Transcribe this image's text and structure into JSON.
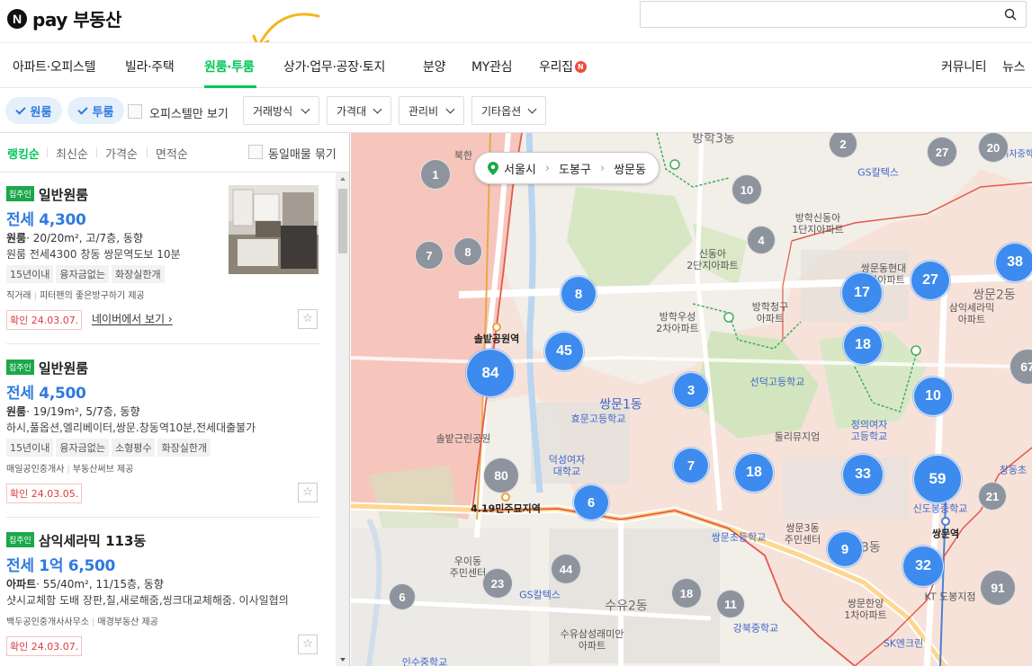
{
  "header": {
    "logo_n": "N",
    "logo_text": "pay 부동산"
  },
  "nav": {
    "items": [
      "아파트·오피스텔",
      "빌라·주택",
      "원룸·투룸",
      "상가·업무·공장·토지",
      "분양",
      "MY관심",
      "우리집"
    ],
    "active_index": 2,
    "badge": "N",
    "right": [
      "커뮤니티",
      "뉴스"
    ]
  },
  "filters": {
    "chip_oneroom": "원룸",
    "chip_tworoom": "투룸",
    "officetel_only": "오피스텔만 보기",
    "dropdowns": [
      "거래방식",
      "가격대",
      "관리비",
      "기타옵션"
    ]
  },
  "sort": {
    "items": [
      "랭킹순",
      "최신순",
      "가격순",
      "면적순"
    ],
    "active_index": 0,
    "group_label": "동일매물 묶기"
  },
  "listings": [
    {
      "badge": "집주인",
      "title": "일반원룸",
      "price": "전세 4,300",
      "spec_type": "원룸",
      "spec": "· 20/20m², 고/7층, 동향",
      "desc": "원룸 전세4300 창동 쌍문역도보 10분",
      "tags": [
        "15년이내",
        "융자금없는",
        "화장실한개"
      ],
      "agent": "직거래",
      "provider": "피터팬의 좋은방구하기 제공",
      "confirm": "확인 24.03.07.",
      "link": "네이버에서 보기 ›"
    },
    {
      "badge": "집주인",
      "title": "일반원룸",
      "price": "전세 4,500",
      "spec_type": "원룸",
      "spec": "· 19/19m², 5/7층, 동향",
      "desc": "하시,풀옵션,엘리베이터,쌍문.창동역10분,전세대출불가",
      "tags": [
        "15년이내",
        "융자금없는",
        "소형평수",
        "화장실한개"
      ],
      "agent": "매일공인중개사",
      "provider": "부동산써브 제공",
      "confirm": "확인 24.03.05."
    },
    {
      "badge": "집주인",
      "title": "삼익세라믹 113동",
      "price": "전세 1억 6,500",
      "spec_type": "아파트",
      "spec": "· 55/40m², 11/15층, 동향",
      "desc": "샷시교체함 도배 장판,칠,새로해줌,씽크대교체해줌. 이사일협의",
      "agent": "백두공인중개사사무소",
      "provider": "매경부동산 제공",
      "confirm": "확인 24.03.07."
    }
  ],
  "map": {
    "breadcrumb": [
      "서울시",
      "도봉구",
      "쌍문동"
    ],
    "clusters_blue": [
      "8",
      "45",
      "84",
      "3",
      "7",
      "18",
      "6",
      "17",
      "27",
      "38",
      "18",
      "10",
      "33",
      "59",
      "9",
      "32"
    ],
    "clusters_grey": [
      "1",
      "7",
      "8",
      "10",
      "4",
      "2",
      "27",
      "20",
      "80",
      "44",
      "23",
      "6",
      "18",
      "11",
      "21",
      "91",
      "67"
    ],
    "labels": {
      "banghak3": "방학3동",
      "ssangmun1": "쌍문1동",
      "ssangmun2": "쌍문2동",
      "ssangmun3": "쌍문3동",
      "suyu2": "수유2동",
      "solbat_station": "솔밭공원역",
      "solbat_park": "솔밭근린공원",
      "minju_station": "4.19민주묘지역",
      "ssangmun_station": "쌍문역",
      "gs_caltex_top": "GS칼텍스",
      "gs_caltex_bottom": "GS칼텍스",
      "banghak_sindonga1": "방학신동아\n1단지아파트",
      "sindonga2": "신동아\n2단지아파트",
      "banghak_woosung": "방학우성\n2차아파트",
      "banghak_chunggu": "방학청구\n아파트",
      "ssangmun_hyundai": "쌍문동현대\n1차아파트",
      "samik_ceramic": "삼익세라믹\n아파트",
      "sundeok_high": "선덕고등학교",
      "dulle_museum": "둘리뮤지엄",
      "jeongui_girls": "정의여자\n고등학교",
      "hyomun_high": "효문고등학교",
      "duksung": "덕성여자\n대학교",
      "ssangmun_elem": "쌍문초등학교",
      "ssangmun3_center": "쌍문3동\n주민센터",
      "sindobong": "신도봉중학교",
      "uidong_center": "우이동\n주민센터",
      "hanyang": "쌍문한양\n1차아파트",
      "kt_dobong": "KT 도봉지점",
      "suyu_samsung": "수유삼성래미안\n아파트",
      "gangbuk_middle": "강북중학교",
      "sk_clean": "SK엔크린",
      "jeongui_girls_middle": "정의여자중학교",
      "changdong_elem": "창동초",
      "bukhan": "북한",
      "isu_high": "인수중학교"
    }
  }
}
